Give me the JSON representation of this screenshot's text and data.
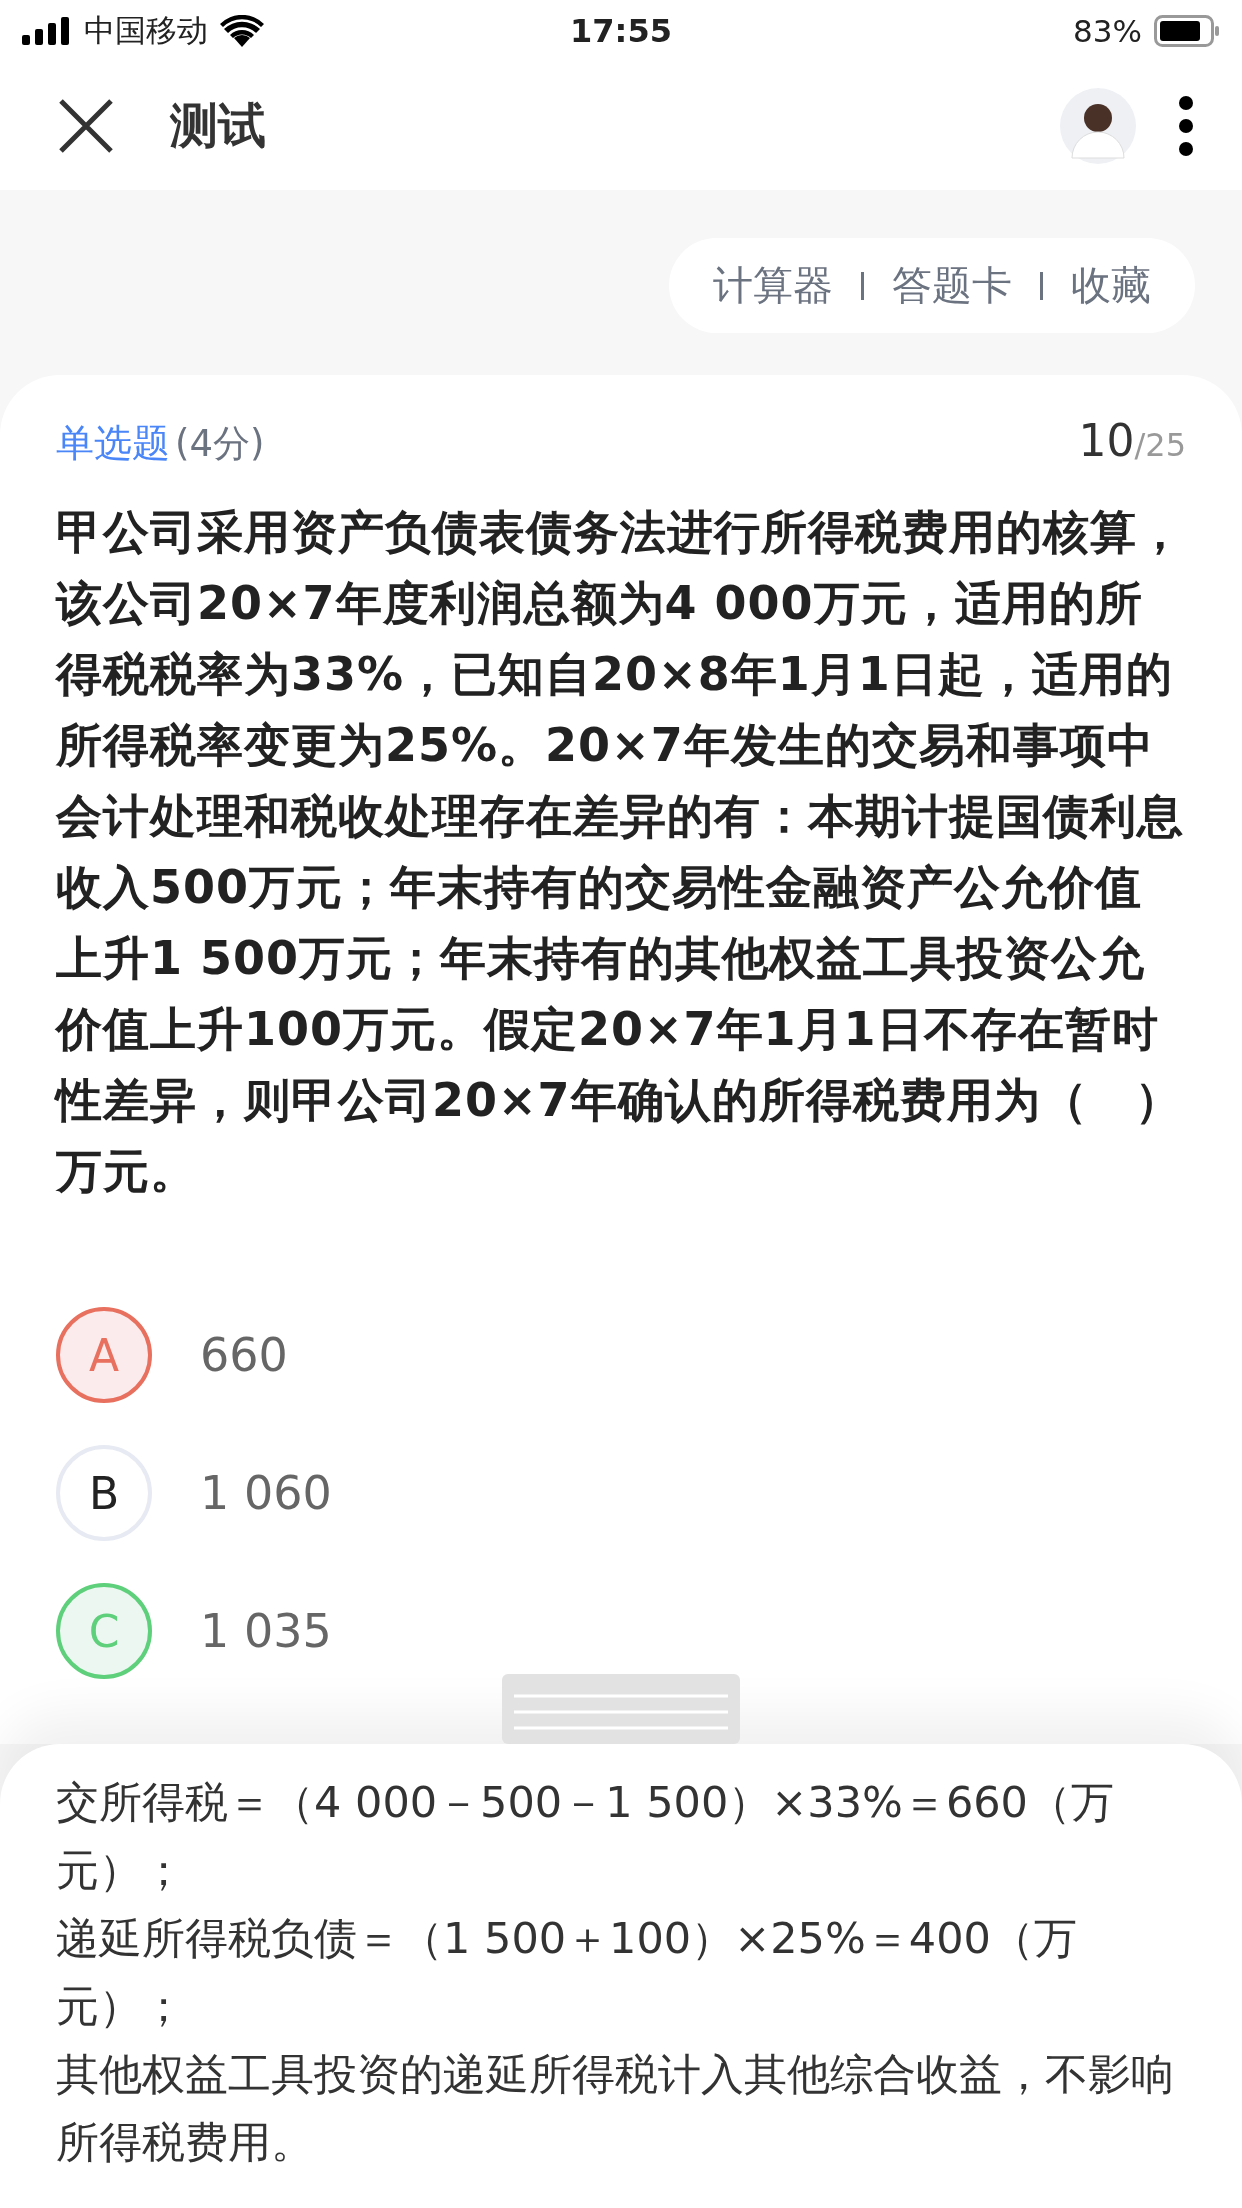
{
  "status_bar": {
    "carrier": "中国移动",
    "time": "17:55",
    "battery": "83%"
  },
  "header": {
    "title": "测试"
  },
  "toolbar": {
    "items": [
      "计算器",
      "答题卡",
      "收藏"
    ]
  },
  "question": {
    "type": "单选题",
    "score": "(4分)",
    "current": "10",
    "total": "/25",
    "text": "甲公司采用资产负债表债务法进行所得税费用的核算，该公司20×7年度利润总额为4 000万元，适用的所得税税率为33%，已知自20×8年1月1日起，适用的所得税率变更为25%。20×7年发生的交易和事项中会计处理和税收处理存在差异的有：本期计提国债利息收入500万元；年末持有的交易性金融资产公允价值上升1 500万元；年末持有的其他权益工具投资公允价值上升100万元。假定20×7年1月1日不存在暂时性差异，则甲公司20×7年确认的所得税费用为（　）万元。"
  },
  "options": [
    {
      "letter": "A",
      "text": "660",
      "selected": true,
      "correct": false
    },
    {
      "letter": "B",
      "text": "1 060",
      "selected": false,
      "correct": false
    },
    {
      "letter": "C",
      "text": "1 035",
      "selected": false,
      "correct": true
    }
  ],
  "analysis": {
    "lines": [
      "交所得税＝（4 000－500－1 500）×33%＝660（万元）；",
      "递延所得税负债＝（1 500＋100）×25%＝400（万元）；",
      "其他权益工具投资的递延所得税计入其他综合收益，不影响所得税费用。"
    ]
  }
}
